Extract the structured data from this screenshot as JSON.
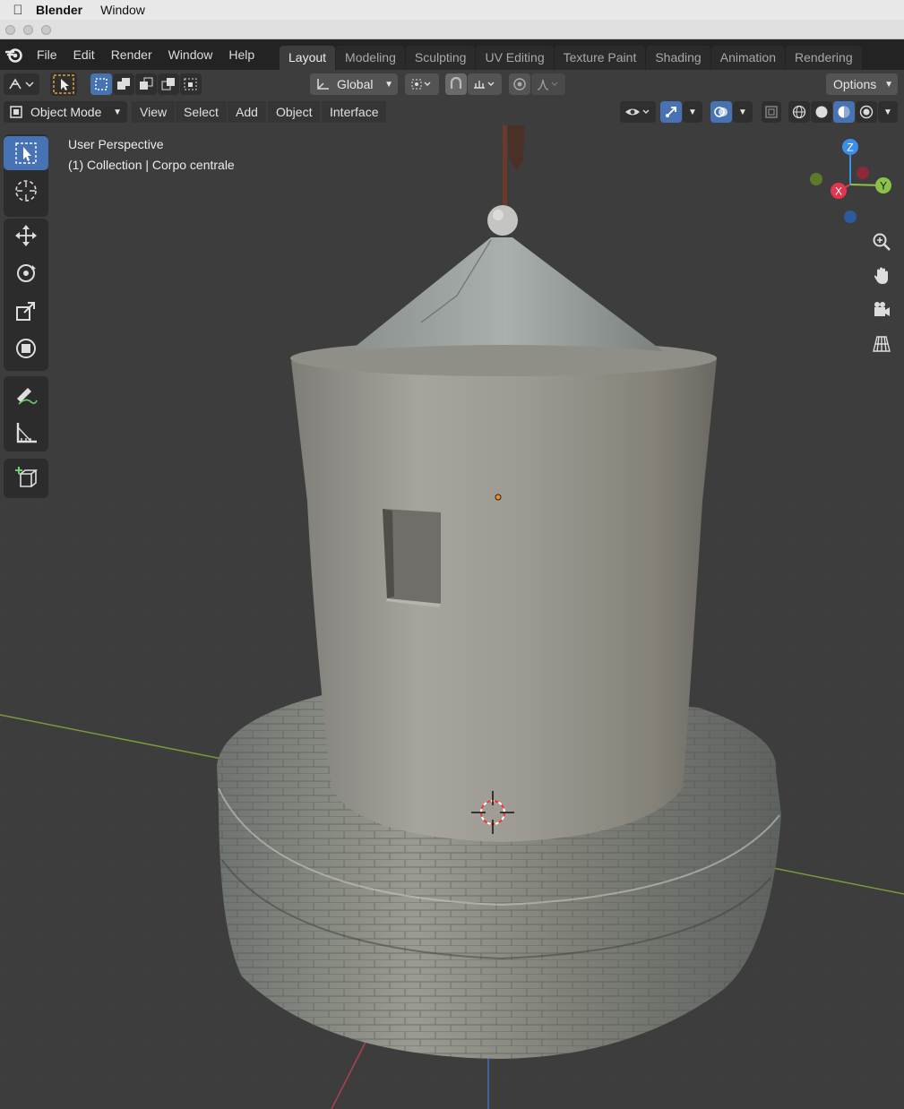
{
  "mac_menubar": {
    "app_name": "Blender",
    "menu_window": "Window"
  },
  "topbar": {
    "menus": [
      "File",
      "Edit",
      "Render",
      "Window",
      "Help"
    ],
    "workspace_tabs": [
      "Layout",
      "Modeling",
      "Sculpting",
      "UV Editing",
      "Texture Paint",
      "Shading",
      "Animation",
      "Rendering"
    ],
    "active_tab": "Layout"
  },
  "tool_header": {
    "transform_orientation": "Global",
    "options_label": "Options"
  },
  "viewport_header": {
    "mode": "Object Mode",
    "menus": [
      "View",
      "Select",
      "Add",
      "Object",
      "Interface"
    ]
  },
  "viewport_info": {
    "perspective": "User Perspective",
    "collection": "(1) Collection | Corpo centrale"
  },
  "gizmo": {
    "z": "Z",
    "y": "Y",
    "x": "X"
  },
  "colors": {
    "accent": "#4772b3",
    "axis_x": "#e0374f",
    "axis_y": "#8bc34a",
    "axis_z": "#3b8fe8"
  }
}
